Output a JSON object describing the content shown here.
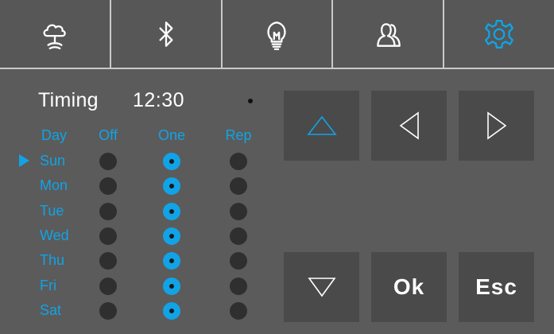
{
  "tabs": [
    {
      "icon": "cloud-weather-icon",
      "active": false
    },
    {
      "icon": "bluetooth-icon",
      "active": false
    },
    {
      "icon": "lightbulb-icon",
      "active": false
    },
    {
      "icon": "users-icon",
      "active": false
    },
    {
      "icon": "gear-icon",
      "active": true
    }
  ],
  "timing": {
    "label": "Timing",
    "time": "12:30"
  },
  "table": {
    "headers": {
      "day": "Day",
      "off": "Off",
      "one": "One",
      "rep": "Rep"
    },
    "selected_day": "Sun",
    "rows": [
      {
        "day": "Sun",
        "mode": "One"
      },
      {
        "day": "Mon",
        "mode": "One"
      },
      {
        "day": "Tue",
        "mode": "One"
      },
      {
        "day": "Wed",
        "mode": "One"
      },
      {
        "day": "Thu",
        "mode": "One"
      },
      {
        "day": "Fri",
        "mode": "One"
      },
      {
        "day": "Sat",
        "mode": "One"
      }
    ]
  },
  "keypad": {
    "up": {
      "icon": "triangle-up-icon",
      "highlighted": true
    },
    "left": {
      "icon": "triangle-left-icon",
      "highlighted": false
    },
    "right": {
      "icon": "triangle-right-icon",
      "highlighted": false
    },
    "down": {
      "icon": "triangle-down-icon",
      "highlighted": false
    },
    "ok_label": "Ok",
    "esc_label": "Esc"
  },
  "colors": {
    "accent": "#11a3e6",
    "tab_bg": "#575757",
    "panel_bg": "#5b5b5b",
    "key_bg": "#4a4a4a",
    "divider": "#c9c9c9"
  }
}
